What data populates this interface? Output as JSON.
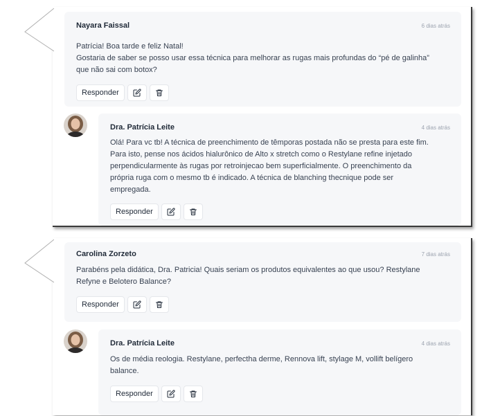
{
  "threads": [
    {
      "comment": {
        "author": "Nayara Faissal",
        "time": "6 dias atrás",
        "lines": [
          "Patrícia! Boa tarde e feliz Natal!",
          "Gostaria de saber se posso usar essa técnica para melhorar as rugas mais profundas do “pé de galinha”",
          "que não sai com botox?"
        ],
        "reply_label": "Responder"
      },
      "reply": {
        "author": "Dra. Patrícia Leite",
        "time": "4 dias atrás",
        "lines": [
          "Olá! Para vc tb! A técnica de preenchimento de têmporas postada não se presta para este fim.",
          "Para isto, pense nos ácidos hialurônico de Alto x stretch como o Restylane refine injetado",
          "perpendicularmente às rugas por retroinjecao bem superficialmente. O preenchimento da",
          "própria ruga com o mesmo tb é indicado. A técnica de blanching thecnique pode ser",
          "empregada."
        ],
        "reply_label": "Responder"
      }
    },
    {
      "comment": {
        "author": "Carolina Zorzeto",
        "time": "7 dias atrás",
        "lines": [
          "Parabéns pela didática, Dra. Patricia! Quais seriam os produtos equivalentes ao que usou? Restylane",
          "Refyne e Belotero Balance?"
        ],
        "reply_label": "Responder"
      },
      "reply": {
        "author": "Dra. Patrícia Leite",
        "time": "4 dias atrás",
        "lines": [
          "Os de média reologia. Restylane, perfectha derme, Rennova lift, stylage M, vollift belígero",
          "balance."
        ],
        "reply_label": "Responder"
      }
    }
  ],
  "icons": {
    "edit": "edit-icon",
    "delete": "trash-icon"
  },
  "colors": {
    "comment_bg": "#f6f7f9",
    "timestamp": "#9ca3af",
    "frame_shadow": "#3a3a3a"
  }
}
